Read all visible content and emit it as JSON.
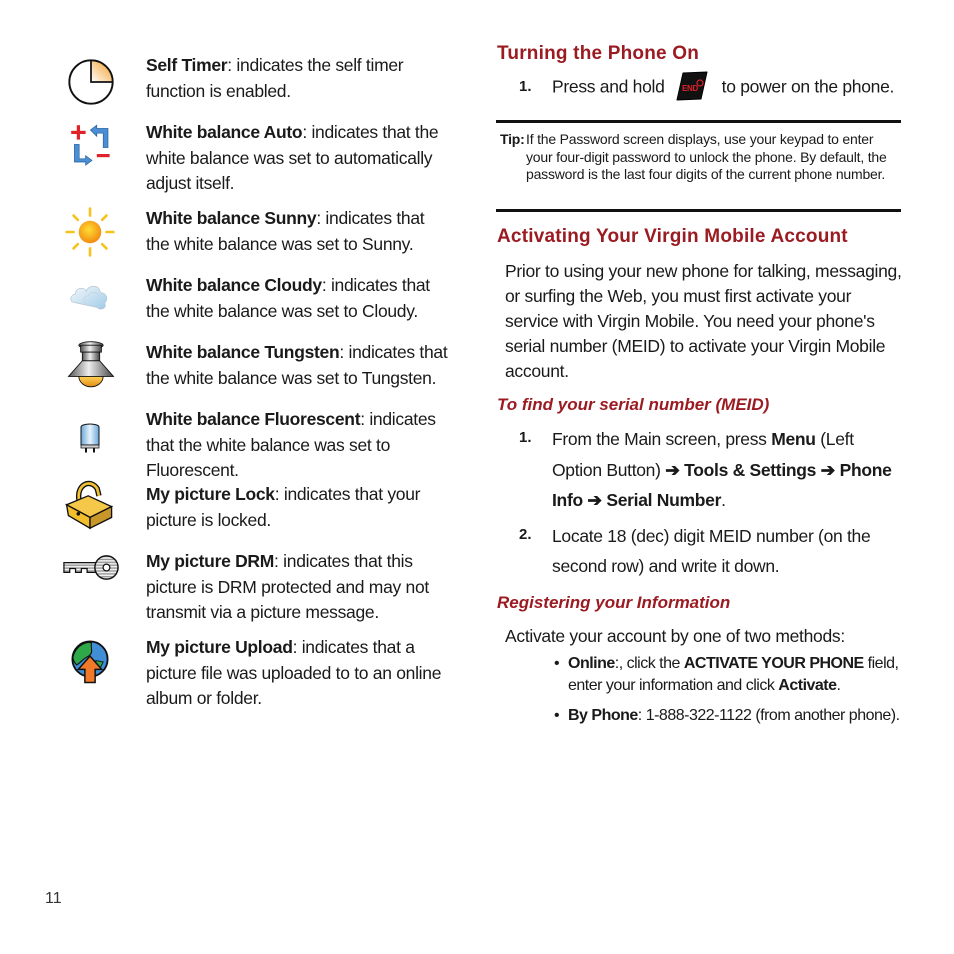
{
  "left_column": {
    "entries": [
      {
        "icon": "self-timer-icon",
        "title": "Self Timer",
        "text": ": indicates the self timer function is enabled."
      },
      {
        "icon": "white-balance-auto-icon",
        "title": "White balance Auto",
        "text": ": indicates that the white balance was set to automatically adjust itself."
      },
      {
        "icon": "white-balance-sunny-icon",
        "title": "White balance Sunny",
        "text": ": indicates that the white balance was set to Sunny."
      },
      {
        "icon": "white-balance-cloudy-icon",
        "title": "White balance Cloudy",
        "text": ": indicates that the white balance was set to Cloudy."
      },
      {
        "icon": "white-balance-tungsten-icon",
        "title": "White balance Tungsten",
        "text": ": indicates that the white balance was set to Tungsten."
      },
      {
        "icon": "white-balance-fluorescent-icon",
        "title": "White balance Fluorescent",
        "text": ": indicates that the white balance was set to Fluorescent."
      },
      {
        "icon": "my-picture-lock-icon",
        "title": "My picture Lock",
        "text": ": indicates that your picture is locked."
      },
      {
        "icon": "my-picture-drm-icon",
        "title": "My picture DRM",
        "text": ": indicates that this picture is DRM protected and may not transmit via a picture message."
      },
      {
        "icon": "my-picture-upload-icon",
        "title": "My picture Upload",
        "text": ": indicates that a picture file was uploaded to to an online album or folder."
      }
    ]
  },
  "right_column": {
    "turning_on": {
      "heading": "Turning the Phone On",
      "step1_num": "1.",
      "step1_before": "Press and hold",
      "step1_key": "END",
      "step1_after": "to power on the phone."
    },
    "tip": {
      "label": "Tip:",
      "text": "If the Password screen displays, use your keypad to enter your four-digit password to unlock the phone. By default, the password is the last four digits of the current phone number."
    },
    "activating": {
      "heading": "Activating Your Virgin Mobile Account",
      "paragraph": "Prior to using your new phone for talking, messaging, or surfing the Web, you must first activate your service with Virgin Mobile. You need your phone's serial number (MEID) to activate your Virgin Mobile account."
    },
    "find_serial": {
      "heading": "To find your serial number (MEID)",
      "steps": [
        {
          "num": "1.",
          "parts": [
            {
              "t": "From the Main screen, press ",
              "b": false
            },
            {
              "t": "Menu",
              "b": true
            },
            {
              "t": " (Left Option Button) ",
              "b": false
            },
            {
              "t": "➔ Tools & Settings ➔ Phone Info ➔ Serial Number",
              "b": true
            },
            {
              "t": ".",
              "b": false
            }
          ]
        },
        {
          "num": "2.",
          "text": "Locate 18 (dec) digit MEID number (on the second row) and write it down."
        }
      ]
    },
    "registering": {
      "heading": "Registering your Information",
      "intro": "Activate your account by one of two methods:",
      "bullets": [
        {
          "parts": [
            {
              "t": "Online",
              "b": true
            },
            {
              "t": ":, click the ",
              "b": false
            },
            {
              "t": "ACTIVATE YOUR PHONE",
              "b": true
            },
            {
              "t": " field, enter your information and click ",
              "b": false
            },
            {
              "t": "Activate",
              "b": true
            },
            {
              "t": ".",
              "b": false
            }
          ]
        },
        {
          "parts": [
            {
              "t": "By Phone",
              "b": true
            },
            {
              "t": ": 1-888-322-1122 (from another phone).",
              "b": false
            }
          ]
        }
      ]
    }
  },
  "footer": {
    "page_number": "11"
  },
  "colors": {
    "heading_red": "#9b1b22",
    "rule": "#111111"
  }
}
